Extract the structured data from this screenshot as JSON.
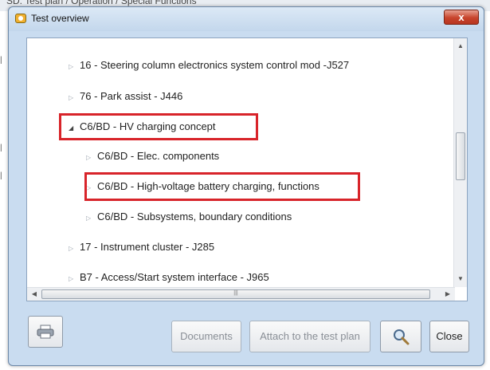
{
  "background": {
    "partial_text": "SD: Test plan / Operation / Special Functions"
  },
  "window": {
    "title": "Test overview",
    "close_glyph": "x"
  },
  "tree": {
    "items": [
      {
        "label": "16 - Steering column electronics system control mod -J527",
        "expanded": false,
        "level": 0,
        "highlighted": false
      },
      {
        "label": "76 - Park assist - J446",
        "expanded": false,
        "level": 0,
        "highlighted": false
      },
      {
        "label": "C6/BD - HV charging concept",
        "expanded": true,
        "level": 0,
        "highlighted": true
      },
      {
        "label": "C6/BD - Elec. components",
        "expanded": false,
        "level": 1,
        "highlighted": false
      },
      {
        "label": "C6/BD - High-voltage battery charging, functions",
        "expanded": false,
        "level": 1,
        "highlighted": true
      },
      {
        "label": "C6/BD - Subsystems, boundary conditions",
        "expanded": false,
        "level": 1,
        "highlighted": false
      },
      {
        "label": "17 - Instrument cluster - J285",
        "expanded": false,
        "level": 0,
        "highlighted": false
      },
      {
        "label": "B7 - Access/Start system interface - J965",
        "expanded": false,
        "level": 0,
        "highlighted": false
      }
    ]
  },
  "buttons": {
    "icon_button": "printer-icon",
    "documents": "Documents",
    "attach": "Attach to the test plan",
    "search": "search-icon",
    "close": "Close"
  },
  "colors": {
    "highlight": "#d8242a",
    "window_bg": "#c9dcf0"
  }
}
